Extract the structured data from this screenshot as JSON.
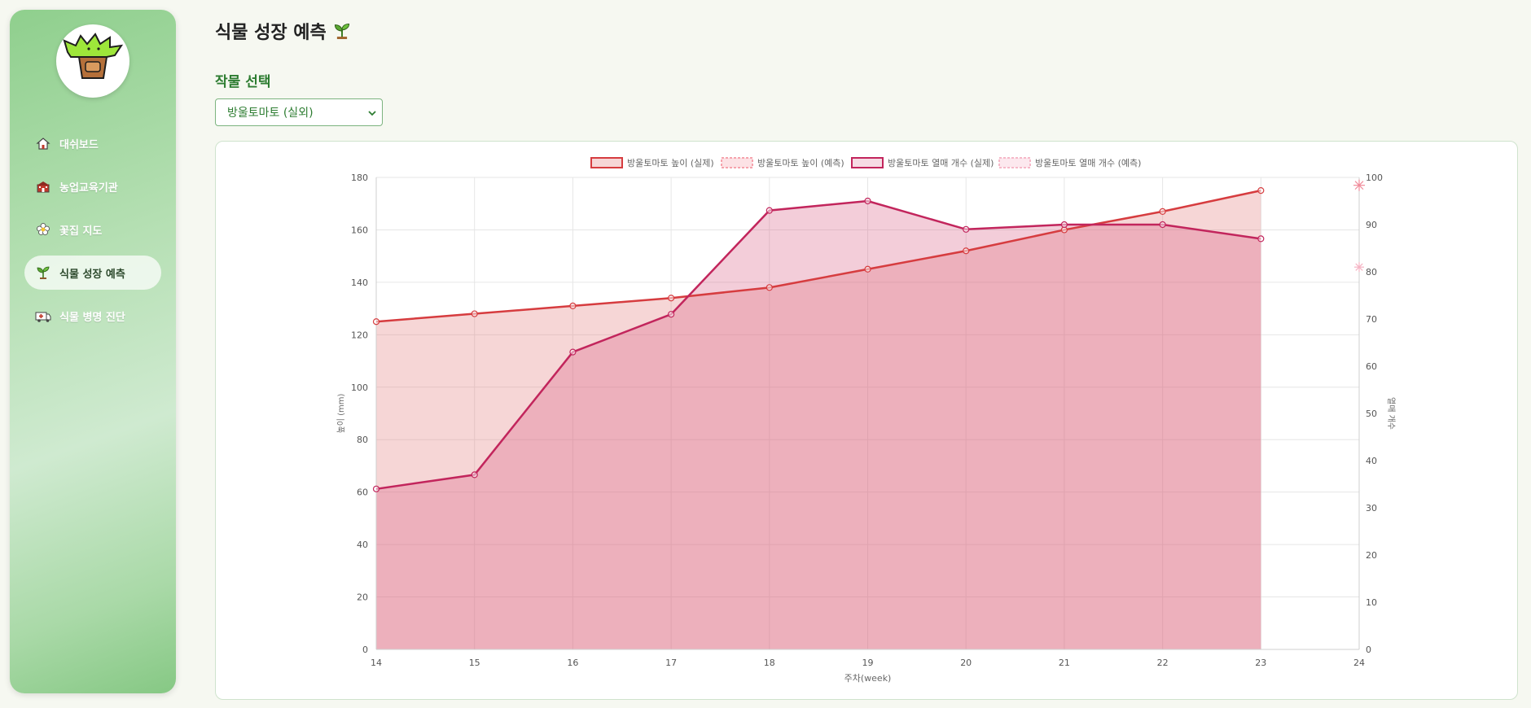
{
  "sidebar": {
    "items": [
      {
        "label": "대쉬보드",
        "icon": "home-icon"
      },
      {
        "label": "농업교육기관",
        "icon": "school-icon"
      },
      {
        "label": "꽃집 지도",
        "icon": "flower-icon"
      },
      {
        "label": "식물 성장 예측",
        "icon": "sprout-icon",
        "active": true
      },
      {
        "label": "식물 병명 진단",
        "icon": "ambulance-icon"
      }
    ]
  },
  "page": {
    "title": "식물 성장 예측",
    "title_icon": "sprout-icon",
    "crop_label": "작물 선택",
    "crop_selected": "방울토마토 (실외)"
  },
  "colors": {
    "height_line": "#d63c3f",
    "height_fill": "rgba(226,120,120,0.30)",
    "fruit_line": "#c2255c",
    "fruit_fill": "rgba(214,90,130,0.30)",
    "accent": "#2e7d32"
  },
  "chart_data": {
    "type": "line",
    "x": [
      14,
      15,
      16,
      17,
      18,
      19,
      20,
      21,
      22,
      23
    ],
    "xlim": [
      14,
      24
    ],
    "xticks": [
      14,
      15,
      16,
      17,
      18,
      19,
      20,
      21,
      22,
      23,
      24
    ],
    "xlabel": "주차(week)",
    "ylabel": "높이 (mm)",
    "ylim": [
      0,
      180
    ],
    "yticks": [
      0,
      20,
      40,
      60,
      80,
      100,
      120,
      140,
      160,
      180
    ],
    "y2label": "열매 개수",
    "y2lim": [
      0,
      100
    ],
    "y2ticks": [
      0,
      10,
      20,
      30,
      40,
      50,
      60,
      70,
      80,
      90,
      100
    ],
    "grid": true,
    "legend_position": "top",
    "series": [
      {
        "name": "방울토마토 높이 (실제)",
        "axis": "left",
        "style": "actual",
        "values": [
          125,
          128,
          131,
          134,
          138,
          145,
          152,
          160,
          167,
          175
        ]
      },
      {
        "name": "방울토마토 높이 (예측)",
        "axis": "left",
        "style": "predicted",
        "points": [
          {
            "x": 24,
            "y": 177
          }
        ]
      },
      {
        "name": "방울토마토 열매 개수 (실제)",
        "axis": "right",
        "style": "actual",
        "values": [
          34,
          37,
          63,
          71,
          93,
          95,
          89,
          90,
          90,
          87
        ]
      },
      {
        "name": "방울토마토 열매 개수 (예측)",
        "axis": "right",
        "style": "predicted",
        "points": [
          {
            "x": 24,
            "y": 81
          }
        ]
      }
    ]
  }
}
